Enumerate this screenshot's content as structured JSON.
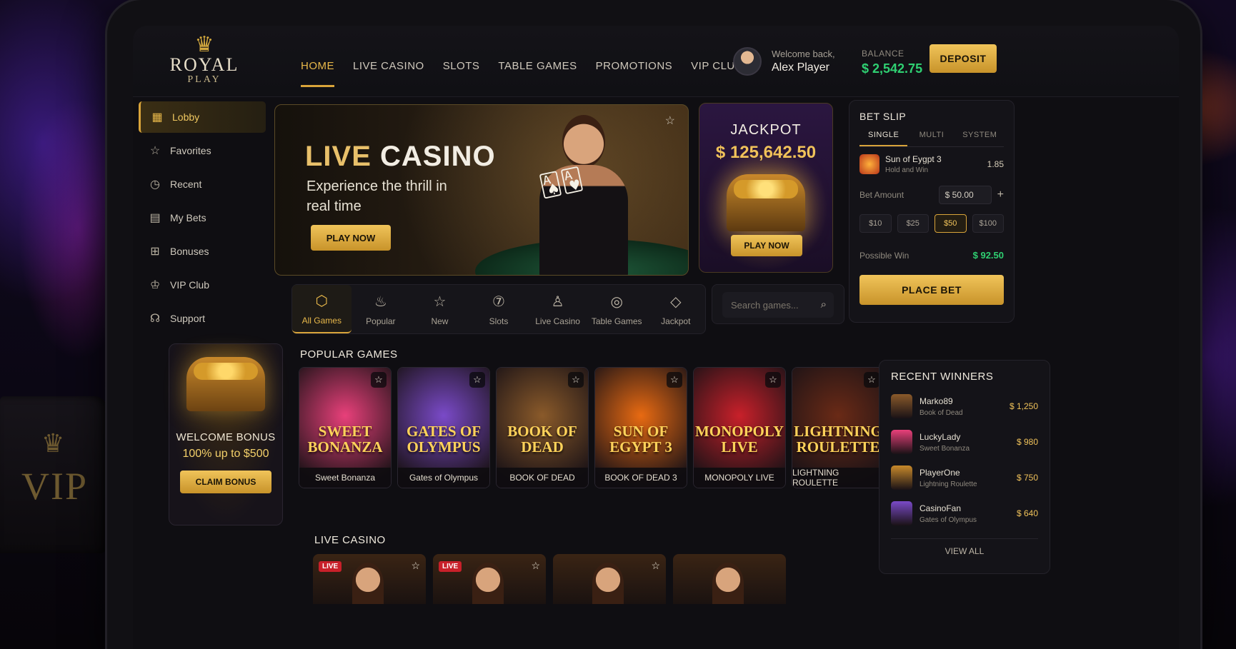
{
  "brand": {
    "line1": "ROYAL",
    "line2": "PLAY"
  },
  "nav": [
    {
      "label": "HOME",
      "active": true
    },
    {
      "label": "LIVE CASINO"
    },
    {
      "label": "SLOTS"
    },
    {
      "label": "TABLE GAMES"
    },
    {
      "label": "PROMOTIONS"
    },
    {
      "label": "VIP CLUB"
    }
  ],
  "user": {
    "welcome": "Welcome back,",
    "name": "Alex Player"
  },
  "balance": {
    "label": "BALANCE",
    "value": "$ 2,542.75"
  },
  "deposit_label": "DEPOSIT",
  "sidebar": {
    "items": [
      {
        "label": "Lobby",
        "icon": "grid-icon",
        "active": true
      },
      {
        "label": "Favorites",
        "icon": "star-icon"
      },
      {
        "label": "Recent",
        "icon": "clock-icon"
      },
      {
        "label": "My Bets",
        "icon": "receipt-icon"
      },
      {
        "label": "Bonuses",
        "icon": "gift-icon"
      },
      {
        "label": "VIP Club",
        "icon": "crown-icon"
      },
      {
        "label": "Support",
        "icon": "headset-icon"
      }
    ],
    "bonus": {
      "title": "WELCOME BONUS",
      "subtitle": "100% up to $500",
      "cta": "CLAIM BONUS"
    }
  },
  "hero": {
    "title_gold": "LIVE",
    "title_white": "CASINO",
    "subtitle": "Experience the thrill in real time",
    "cta": "PLAY NOW"
  },
  "jackpot": {
    "title": "JACKPOT",
    "value": "$ 125,642.50",
    "cta": "PLAY NOW"
  },
  "categories": [
    {
      "label": "All Games",
      "icon": "cube-icon",
      "active": true
    },
    {
      "label": "Popular",
      "icon": "flame-icon"
    },
    {
      "label": "New",
      "icon": "star-icon"
    },
    {
      "label": "Slots",
      "icon": "slot-icon"
    },
    {
      "label": "Live Casino",
      "icon": "dealer-icon"
    },
    {
      "label": "Table Games",
      "icon": "chip-icon"
    },
    {
      "label": "Jackpot",
      "icon": "diamond-icon"
    }
  ],
  "search": {
    "placeholder": "Search games..."
  },
  "popular": {
    "title": "POPULAR GAMES",
    "games": [
      {
        "name": "Sweet Bonanza",
        "logo": "SWEET BONANZA",
        "color": "#e8407a"
      },
      {
        "name": "Gates of Olympus",
        "logo": "GATES OF OLYMPUS",
        "color": "#7a4ac8"
      },
      {
        "name": "BOOK OF DEAD",
        "logo": "BOOK OF DEAD",
        "color": "#8a5a2a"
      },
      {
        "name": "BOOK OF DEAD 3",
        "logo": "SUN OF EGYPT 3",
        "color": "#e86a12"
      },
      {
        "name": "MONOPOLY LIVE",
        "logo": "MONOPOLY LIVE",
        "color": "#c8202a"
      },
      {
        "name": "LIGHTNING ROULETTE",
        "logo": "LIGHTNING ROULETTE",
        "color": "#6a2a16"
      }
    ]
  },
  "live_casino": {
    "title": "LIVE CASINO",
    "badge": "LIVE"
  },
  "betslip": {
    "title": "BET SLIP",
    "tabs": [
      "SINGLE",
      "MULTI",
      "SYSTEM"
    ],
    "pick": {
      "game": "Sun of Eygpt 3",
      "market": "Hold and Win",
      "odds": "1.85"
    },
    "amount_label": "Bet Amount",
    "amount": "$ 50.00",
    "chips": [
      "$10",
      "$25",
      "$50",
      "$100"
    ],
    "active_chip": "$50",
    "possible_win_label": "Possible Win",
    "possible_win": "$ 92.50",
    "cta": "PLACE BET"
  },
  "winners": {
    "title": "RECENT WINNERS",
    "rows": [
      {
        "name": "Marko89",
        "game": "Book of Dead",
        "amount": "$ 1,250",
        "color": "#8a5a2a"
      },
      {
        "name": "LuckyLady",
        "game": "Sweet Bonanza",
        "amount": "$ 980",
        "color": "#e8407a"
      },
      {
        "name": "PlayerOne",
        "game": "Lightning Roulette",
        "amount": "$ 750",
        "color": "#c8892b"
      },
      {
        "name": "CasinoFan",
        "game": "Gates of Olympus",
        "amount": "$ 640",
        "color": "#7a4ac8"
      }
    ],
    "view_all": "VIEW ALL"
  }
}
